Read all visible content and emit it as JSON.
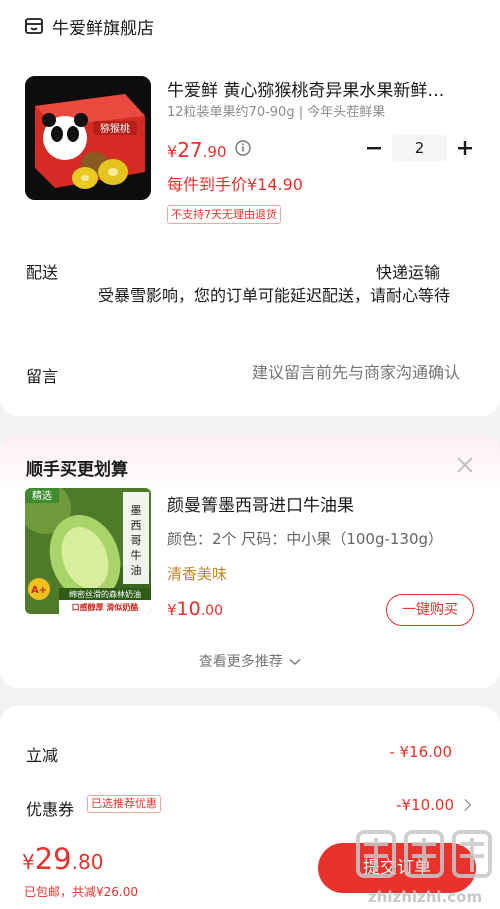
{
  "shop": {
    "name": "牛爱鲜旗舰店"
  },
  "product": {
    "title": "牛爱鲜 黄心猕猴桃奇异果水果新鲜…",
    "spec": "12粒装单果约70-90g | 今年头茬鲜果",
    "price_symbol": "¥",
    "price_int": "27",
    "price_dec": ".90",
    "quantity": "2",
    "unit_price": "每件到手价¥14.90",
    "no_return_tag": "不支持7天无理由退货",
    "image_text": "猕猴桃"
  },
  "shipping": {
    "label": "配送",
    "method": "快递运输",
    "notice": "受暴雪影响，您的订单可能延迟配送，请耐心等待"
  },
  "message": {
    "label": "留言",
    "placeholder": "建议留言前先与商家沟通确认"
  },
  "recommend": {
    "title": "顺手买更划算",
    "name": "颜曼箐墨西哥进口牛油果",
    "spec": "颜色：2个   尺码：中小果（100g-130g）",
    "tag": "清香美味",
    "price_symbol": "¥",
    "price_int": "10",
    "price_dec": ".00",
    "buy_label": "一键购买",
    "more_label": "查看更多推荐",
    "image_badge_top": "精选",
    "image_side_text": "墨西哥牛油果",
    "image_grade": "A+",
    "image_bottom_1": "绵密丝滑的森林奶油",
    "image_bottom_2": "口感醇厚 滑似奶酪"
  },
  "summary": {
    "discount_label": "立减",
    "discount_value": "- ¥16.00",
    "coupon_label": "优惠券",
    "coupon_tag": "已选推荐优惠",
    "coupon_value": "-¥10.00"
  },
  "footer": {
    "total_symbol": "¥",
    "total_int": "29",
    "total_dec": ".80",
    "total_note": "已包邮，共减¥26.00",
    "submit_label": "提交订单"
  },
  "colors": {
    "accent": "#e8322b",
    "tag_gold": "#c0882a",
    "page_bg": "#f2f2f2"
  }
}
